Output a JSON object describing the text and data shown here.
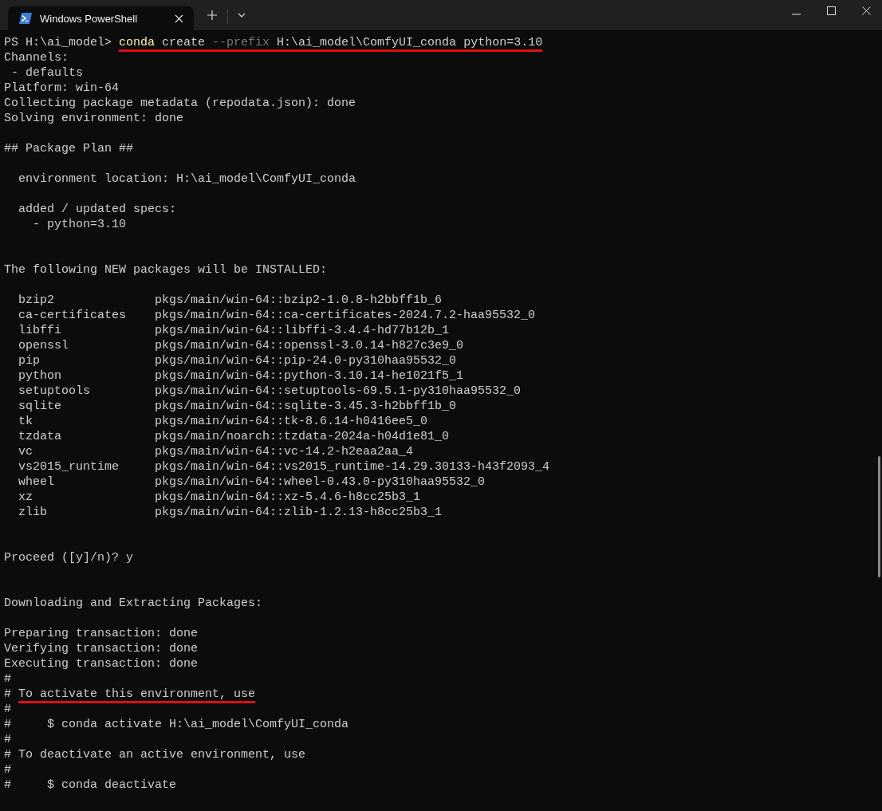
{
  "window": {
    "tab_title": "Windows PowerShell"
  },
  "terminal": {
    "lines": [
      {
        "kind": "command",
        "prompt": "PS H:\\ai_model> ",
        "underlined": true,
        "segments": [
          {
            "kind": "program",
            "text": "conda"
          },
          {
            "kind": "argument",
            "text": "create"
          },
          {
            "kind": "flag",
            "text": "--prefix"
          },
          {
            "kind": "argument",
            "text": "H:\\ai_model\\ComfyUI_conda"
          },
          {
            "kind": "argument",
            "text": "python=3.10"
          }
        ]
      },
      {
        "kind": "output",
        "text": "Channels:"
      },
      {
        "kind": "output",
        "text": " - defaults"
      },
      {
        "kind": "output",
        "text": "Platform: win-64"
      },
      {
        "kind": "output",
        "text": "Collecting package metadata (repodata.json): done"
      },
      {
        "kind": "output",
        "text": "Solving environment: done"
      },
      {
        "kind": "blank"
      },
      {
        "kind": "output",
        "text": "## Package Plan ##"
      },
      {
        "kind": "blank"
      },
      {
        "kind": "output",
        "text": "  environment location: H:\\ai_model\\ComfyUI_conda"
      },
      {
        "kind": "blank"
      },
      {
        "kind": "output",
        "text": "  added / updated specs:"
      },
      {
        "kind": "output",
        "text": "    - python=3.10"
      },
      {
        "kind": "blank"
      },
      {
        "kind": "blank"
      },
      {
        "kind": "output",
        "text": "The following NEW packages will be INSTALLED:"
      },
      {
        "kind": "blank"
      },
      {
        "kind": "package",
        "name": "bzip2",
        "spec": "pkgs/main/win-64::bzip2-1.0.8-h2bbff1b_6"
      },
      {
        "kind": "package",
        "name": "ca-certificates",
        "spec": "pkgs/main/win-64::ca-certificates-2024.7.2-haa95532_0"
      },
      {
        "kind": "package",
        "name": "libffi",
        "spec": "pkgs/main/win-64::libffi-3.4.4-hd77b12b_1"
      },
      {
        "kind": "package",
        "name": "openssl",
        "spec": "pkgs/main/win-64::openssl-3.0.14-h827c3e9_0"
      },
      {
        "kind": "package",
        "name": "pip",
        "spec": "pkgs/main/win-64::pip-24.0-py310haa95532_0"
      },
      {
        "kind": "package",
        "name": "python",
        "spec": "pkgs/main/win-64::python-3.10.14-he1021f5_1"
      },
      {
        "kind": "package",
        "name": "setuptools",
        "spec": "pkgs/main/win-64::setuptools-69.5.1-py310haa95532_0"
      },
      {
        "kind": "package",
        "name": "sqlite",
        "spec": "pkgs/main/win-64::sqlite-3.45.3-h2bbff1b_0"
      },
      {
        "kind": "package",
        "name": "tk",
        "spec": "pkgs/main/win-64::tk-8.6.14-h0416ee5_0"
      },
      {
        "kind": "package",
        "name": "tzdata",
        "spec": "pkgs/main/noarch::tzdata-2024a-h04d1e81_0"
      },
      {
        "kind": "package",
        "name": "vc",
        "spec": "pkgs/main/win-64::vc-14.2-h2eaa2aa_4"
      },
      {
        "kind": "package",
        "name": "vs2015_runtime",
        "spec": "pkgs/main/win-64::vs2015_runtime-14.29.30133-h43f2093_4"
      },
      {
        "kind": "package",
        "name": "wheel",
        "spec": "pkgs/main/win-64::wheel-0.43.0-py310haa95532_0"
      },
      {
        "kind": "package",
        "name": "xz",
        "spec": "pkgs/main/win-64::xz-5.4.6-h8cc25b3_1"
      },
      {
        "kind": "package",
        "name": "zlib",
        "spec": "pkgs/main/win-64::zlib-1.2.13-h8cc25b3_1"
      },
      {
        "kind": "blank"
      },
      {
        "kind": "blank"
      },
      {
        "kind": "output",
        "text": "Proceed ([y]/n)? y"
      },
      {
        "kind": "blank"
      },
      {
        "kind": "blank"
      },
      {
        "kind": "output",
        "text": "Downloading and Extracting Packages:"
      },
      {
        "kind": "blank"
      },
      {
        "kind": "output",
        "text": "Preparing transaction: done"
      },
      {
        "kind": "output",
        "text": "Verifying transaction: done"
      },
      {
        "kind": "output",
        "text": "Executing transaction: done"
      },
      {
        "kind": "output",
        "text": "#"
      },
      {
        "kind": "comment",
        "prefix": "#",
        "text": "To activate this environment, use",
        "underlined": true
      },
      {
        "kind": "output",
        "text": "#"
      },
      {
        "kind": "output",
        "text": "#     $ conda activate H:\\ai_model\\ComfyUI_conda"
      },
      {
        "kind": "output",
        "text": "#"
      },
      {
        "kind": "output",
        "text": "# To deactivate an active environment, use"
      },
      {
        "kind": "output",
        "text": "#"
      },
      {
        "kind": "output",
        "text": "#     $ conda deactivate"
      }
    ]
  }
}
